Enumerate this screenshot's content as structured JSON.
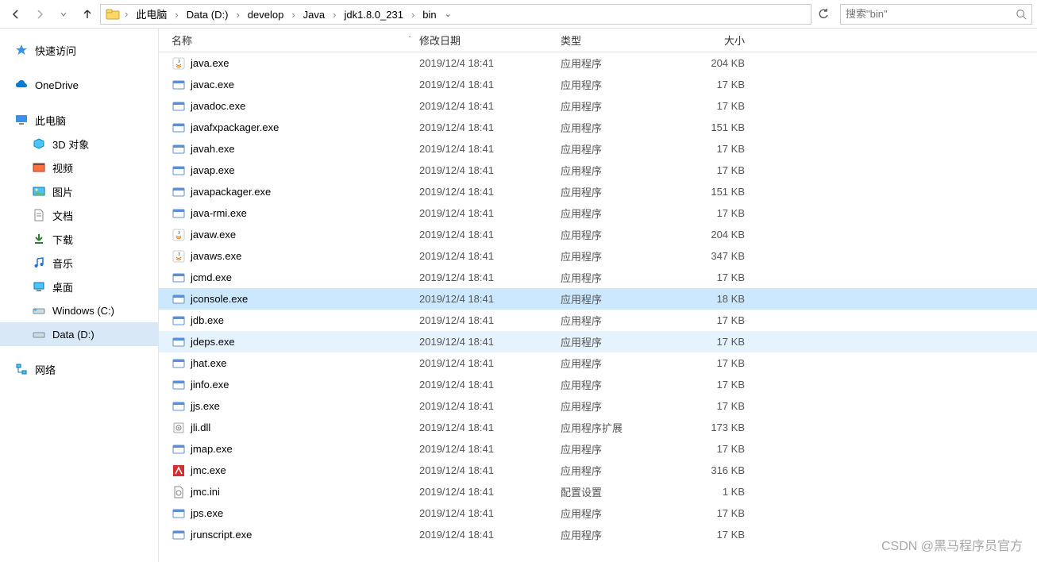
{
  "breadcrumb": {
    "items": [
      "此电脑",
      "Data (D:)",
      "develop",
      "Java",
      "jdk1.8.0_231",
      "bin"
    ]
  },
  "search": {
    "placeholder": "搜索\"bin\""
  },
  "sidebar": {
    "quick_access": "快速访问",
    "onedrive": "OneDrive",
    "this_pc": "此电脑",
    "objects3d": "3D 对象",
    "videos": "视频",
    "pictures": "图片",
    "documents": "文档",
    "downloads": "下载",
    "music": "音乐",
    "desktop": "桌面",
    "drive_c": "Windows (C:)",
    "drive_d": "Data (D:)",
    "network": "网络"
  },
  "columns": {
    "name": "名称",
    "date": "修改日期",
    "type": "类型",
    "size": "大小"
  },
  "types": {
    "app": "应用程序",
    "dll": "应用程序扩展",
    "ini": "配置设置"
  },
  "files": [
    {
      "name": "java.exe",
      "date": "2019/12/4 18:41",
      "typeKey": "app",
      "size": "204 KB",
      "icon": "java"
    },
    {
      "name": "javac.exe",
      "date": "2019/12/4 18:41",
      "typeKey": "app",
      "size": "17 KB",
      "icon": "exe"
    },
    {
      "name": "javadoc.exe",
      "date": "2019/12/4 18:41",
      "typeKey": "app",
      "size": "17 KB",
      "icon": "exe"
    },
    {
      "name": "javafxpackager.exe",
      "date": "2019/12/4 18:41",
      "typeKey": "app",
      "size": "151 KB",
      "icon": "exe"
    },
    {
      "name": "javah.exe",
      "date": "2019/12/4 18:41",
      "typeKey": "app",
      "size": "17 KB",
      "icon": "exe"
    },
    {
      "name": "javap.exe",
      "date": "2019/12/4 18:41",
      "typeKey": "app",
      "size": "17 KB",
      "icon": "exe"
    },
    {
      "name": "javapackager.exe",
      "date": "2019/12/4 18:41",
      "typeKey": "app",
      "size": "151 KB",
      "icon": "exe"
    },
    {
      "name": "java-rmi.exe",
      "date": "2019/12/4 18:41",
      "typeKey": "app",
      "size": "17 KB",
      "icon": "exe"
    },
    {
      "name": "javaw.exe",
      "date": "2019/12/4 18:41",
      "typeKey": "app",
      "size": "204 KB",
      "icon": "java"
    },
    {
      "name": "javaws.exe",
      "date": "2019/12/4 18:41",
      "typeKey": "app",
      "size": "347 KB",
      "icon": "java"
    },
    {
      "name": "jcmd.exe",
      "date": "2019/12/4 18:41",
      "typeKey": "app",
      "size": "17 KB",
      "icon": "exe"
    },
    {
      "name": "jconsole.exe",
      "date": "2019/12/4 18:41",
      "typeKey": "app",
      "size": "18 KB",
      "icon": "exe",
      "selected": true
    },
    {
      "name": "jdb.exe",
      "date": "2019/12/4 18:41",
      "typeKey": "app",
      "size": "17 KB",
      "icon": "exe"
    },
    {
      "name": "jdeps.exe",
      "date": "2019/12/4 18:41",
      "typeKey": "app",
      "size": "17 KB",
      "icon": "exe",
      "hover": true
    },
    {
      "name": "jhat.exe",
      "date": "2019/12/4 18:41",
      "typeKey": "app",
      "size": "17 KB",
      "icon": "exe"
    },
    {
      "name": "jinfo.exe",
      "date": "2019/12/4 18:41",
      "typeKey": "app",
      "size": "17 KB",
      "icon": "exe"
    },
    {
      "name": "jjs.exe",
      "date": "2019/12/4 18:41",
      "typeKey": "app",
      "size": "17 KB",
      "icon": "exe"
    },
    {
      "name": "jli.dll",
      "date": "2019/12/4 18:41",
      "typeKey": "dll",
      "size": "173 KB",
      "icon": "dll"
    },
    {
      "name": "jmap.exe",
      "date": "2019/12/4 18:41",
      "typeKey": "app",
      "size": "17 KB",
      "icon": "exe"
    },
    {
      "name": "jmc.exe",
      "date": "2019/12/4 18:41",
      "typeKey": "app",
      "size": "316 KB",
      "icon": "jmc"
    },
    {
      "name": "jmc.ini",
      "date": "2019/12/4 18:41",
      "typeKey": "ini",
      "size": "1 KB",
      "icon": "ini"
    },
    {
      "name": "jps.exe",
      "date": "2019/12/4 18:41",
      "typeKey": "app",
      "size": "17 KB",
      "icon": "exe"
    },
    {
      "name": "jrunscript.exe",
      "date": "2019/12/4 18:41",
      "typeKey": "app",
      "size": "17 KB",
      "icon": "exe"
    }
  ],
  "watermark": "CSDN @黑马程序员官方"
}
